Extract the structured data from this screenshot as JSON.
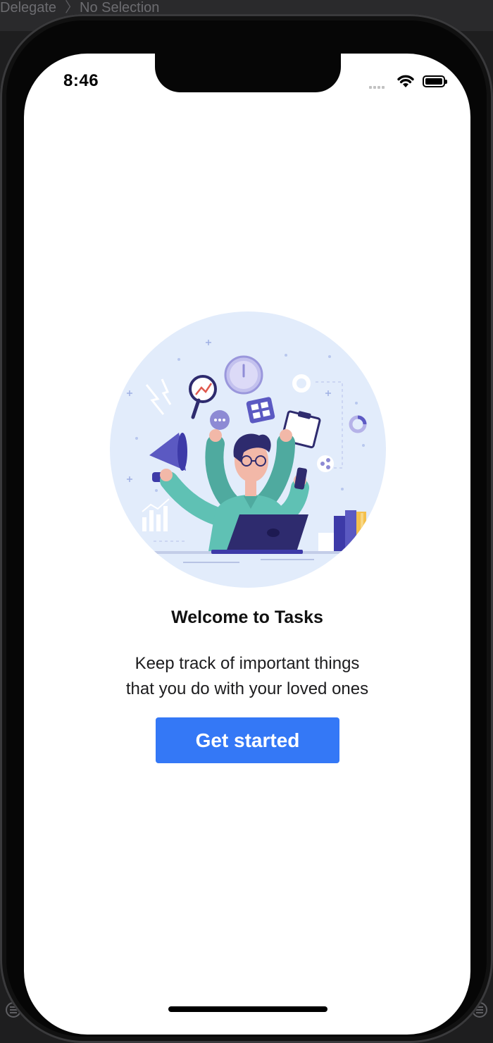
{
  "ide": {
    "breadcrumb_left": "Delegate",
    "breadcrumb_separator": "〉",
    "breadcrumb_right": "No Selection"
  },
  "status_bar": {
    "time": "8:46",
    "icons": [
      "signal-icon",
      "wifi-icon",
      "battery-icon"
    ]
  },
  "onboarding": {
    "illustration": "multitasking-person-illustration",
    "title": "Welcome to Tasks",
    "subtitle_lines": [
      "Keep track of important things",
      "that you do with your loved ones"
    ],
    "cta_label": "Get started"
  },
  "colors": {
    "accent": "#3478f6",
    "illustration_bg": "#e2ecfb",
    "illustration_primary": "#5fc1b4",
    "illustration_dark": "#2e2b6e"
  }
}
